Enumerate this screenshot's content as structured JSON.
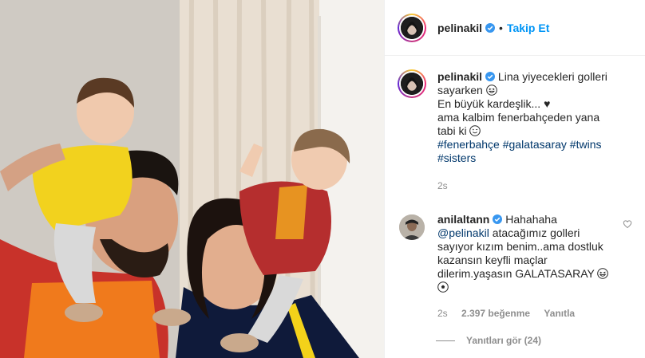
{
  "header": {
    "username": "pelinakil",
    "separator": "•",
    "follow_label": "Takip Et"
  },
  "caption": {
    "username": "pelinakil",
    "line1": "Lina yiyecekleri golleri sayarken",
    "line2": "En büyük kardeşlik...",
    "heart_glyph": "♥",
    "line3": "ama kalbim fenerbahçeden yana tabi ki",
    "hashtags": [
      "#fenerbahçe",
      "#galatasaray",
      "#twins",
      "#sisters"
    ],
    "time": "2s"
  },
  "comment": {
    "username": "anilaltann",
    "mention": "@pelinakil",
    "text_before": "Hahahaha",
    "text_after": "atacağımız golleri sayıyor kızım benim..ama dostluk kazansın keyfli maçlar dilerim.yaşasın GALATASARAY",
    "time": "2s",
    "likes": "2.397 beğenme",
    "reply_label": "Yanıtla",
    "view_replies": "Yanıtları gör (24)"
  },
  "icons": {
    "verified": "verified-badge-icon",
    "heart": "heart-outline-icon",
    "emoji_grin": "grinning-squint-emoji",
    "emoji_wink": "winking-emoji",
    "emoji_laugh": "laughing-tears-emoji",
    "emoji_ball": "soccer-ball-emoji"
  },
  "colors": {
    "link": "#0095f6",
    "hashtag": "#00376b",
    "muted": "#8e8e8e",
    "text": "#262626"
  }
}
